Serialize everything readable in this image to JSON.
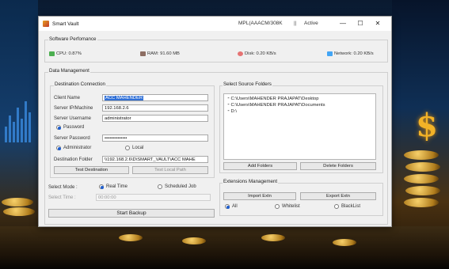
{
  "window": {
    "title": "Smart Vault",
    "user_info": "MPL(AAACM/308K",
    "separator": "||",
    "status": "Active",
    "minimize": "—",
    "maximize": "☐",
    "close": "✕"
  },
  "performance": {
    "group_title": "Software Perfomance",
    "cpu": "CPU: 0.87%",
    "ram": "RAM: 91.60 MB",
    "disk": "Disk: 0.20 KB/s",
    "network": "Network: 0.20 KB/s"
  },
  "data_management": {
    "group_title": "Data Management",
    "destination": {
      "group_title": "Destination Connection",
      "client_name_label": "Client Name",
      "client_name_value": "ACC MAHENDER",
      "server_ip_label": "Server IP/Machine",
      "server_ip_value": "192.168.2.6",
      "server_username_label": "Server Username",
      "server_username_value": "administrator",
      "password_radio": "Password",
      "server_password_label": "Server Password",
      "server_password_value": "••••••••••••••",
      "administrator_radio": "Administrator",
      "local_radio": "Local",
      "destination_folder_label": "Destination Folder",
      "destination_folder_value": "\\\\192.168.2.6\\D\\SMART_VAULT\\ACC MAHE",
      "test_destination": "Test Destination",
      "test_local_path": "Test Local Path"
    },
    "select_mode_label": "Select Mode :",
    "real_time": "Real Time",
    "scheduled_job": "Scheduled Job",
    "select_time_label": "Select Time :",
    "select_time_value": "00:00:00",
    "start_backup": "Start Backup",
    "source": {
      "group_title": "Select Source Folders",
      "folders": [
        "C:\\Users\\MAHENDER PRAJAPAT\\Desktop",
        "C:\\Users\\MAHENDER PRAJAPAT\\Documents",
        "D:\\"
      ],
      "add_folders": "Add Folders",
      "delete_folders": "Delete Folders"
    },
    "extensions": {
      "group_title": "Extensions Management",
      "import": "Import Extn",
      "export": "Export Extn",
      "all": "All",
      "whitelist": "Whitelist",
      "blacklist": "BlackList"
    }
  },
  "colors": {
    "selection": "#2f6fd6",
    "radio_selected": "#1f5fcf",
    "dollar": "#f2b227"
  }
}
